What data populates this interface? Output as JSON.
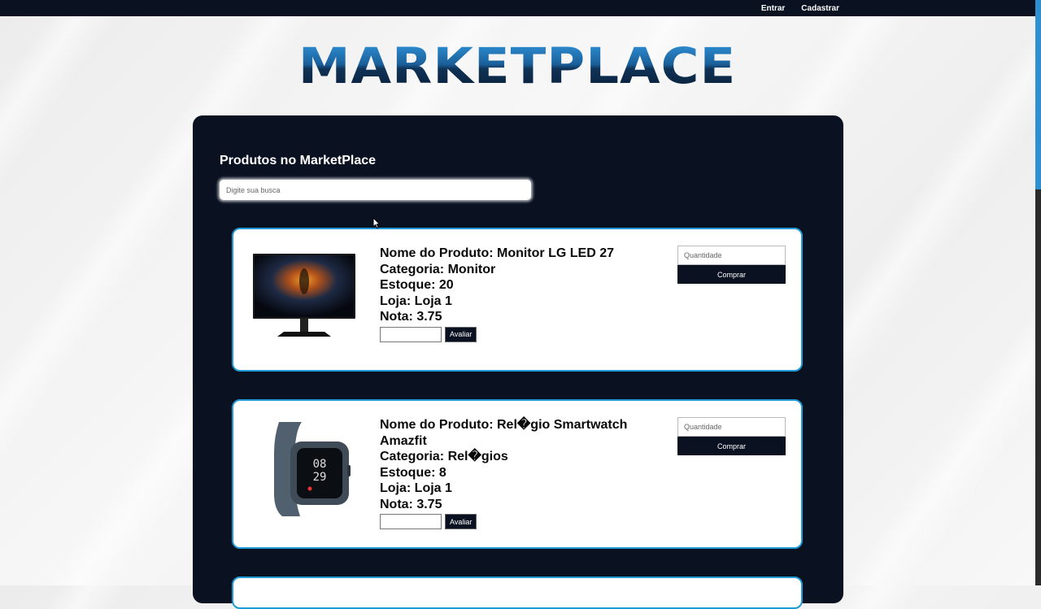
{
  "nav": {
    "login": "Entrar",
    "register": "Cadastrar"
  },
  "logo": "MARKETPLACE",
  "panel": {
    "title": "Produtos no MarketPlace",
    "search_placeholder": "Digite sua busca"
  },
  "products": [
    {
      "name": "Nome do Produto: Monitor LG LED 27",
      "category": "Categoria: Monitor",
      "stock": "Estoque: 20",
      "store": "Loja: Loja 1",
      "rating": "Nota: 3.75",
      "rate_button": "Avaliar",
      "qty_placeholder": "Quantidade",
      "buy_button": "Comprar",
      "image_icon": "monitor-image"
    },
    {
      "name": "Nome do Produto: Rel�gio Smartwatch Amazfit",
      "category": "Categoria: Rel�gios",
      "stock": "Estoque: 8",
      "store": "Loja: Loja 1",
      "rating": "Nota: 3.75",
      "rate_button": "Avaliar",
      "qty_placeholder": "Quantidade",
      "buy_button": "Comprar",
      "image_icon": "smartwatch-image"
    }
  ],
  "colors": {
    "navy": "#0a1222",
    "card_border": "#1f9ad6",
    "scroll_thumb": "#2f8fcf"
  }
}
